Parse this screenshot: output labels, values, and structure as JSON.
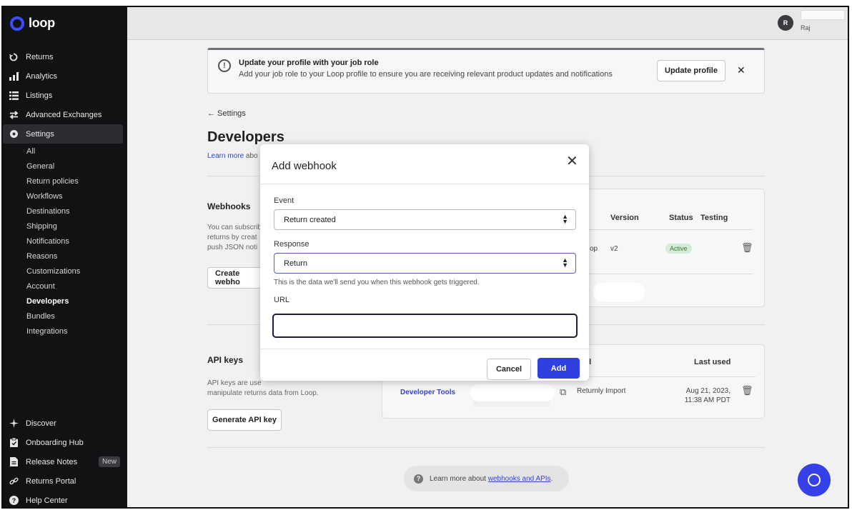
{
  "app": {
    "logo_text": "loop",
    "brand_color": "#3d4bff"
  },
  "user": {
    "avatar_initial": "R",
    "name": "Raj"
  },
  "sidebar": {
    "items": [
      {
        "label": "Returns",
        "icon": "returns-icon"
      },
      {
        "label": "Analytics",
        "icon": "analytics-icon"
      },
      {
        "label": "Listings",
        "icon": "listings-icon"
      },
      {
        "label": "Advanced Exchanges",
        "icon": "exchange-icon"
      },
      {
        "label": "Settings",
        "icon": "settings-icon"
      }
    ],
    "settings_sub": [
      "All",
      "General",
      "Return policies",
      "Workflows",
      "Destinations",
      "Shipping",
      "Notifications",
      "Reasons",
      "Customizations",
      "Account",
      "Developers",
      "Bundles",
      "Integrations"
    ],
    "bottom": [
      {
        "label": "Discover",
        "icon": "discover-icon"
      },
      {
        "label": "Onboarding Hub",
        "icon": "clipboard-icon"
      },
      {
        "label": "Release Notes",
        "icon": "document-icon",
        "badge": "New"
      },
      {
        "label": "Returns Portal",
        "icon": "link-icon"
      },
      {
        "label": "Help Center",
        "icon": "help-icon"
      }
    ]
  },
  "banner": {
    "title": "Update your profile with your job role",
    "text": "Add your job role to your Loop profile to ensure you are receiving relevant product updates and notifications",
    "button": "Update profile"
  },
  "page": {
    "back_label": "← Settings",
    "title": "Developers",
    "learn_more_link": "Learn more",
    "learn_more_rest": " abo"
  },
  "webhooks": {
    "title": "Webhooks",
    "desc_lines": [
      "You can subscrib",
      "returns by creat",
      "push JSON noti"
    ],
    "create_button": "Create webho",
    "columns": {
      "version": "Version",
      "status": "Status",
      "testing": "Testing"
    },
    "row": {
      "fragment": "op",
      "version": "v2",
      "status": "Active"
    }
  },
  "api_keys": {
    "title": "API keys",
    "desc_lines": [
      "API keys are use",
      "manipulate returns data from Loop."
    ],
    "generate_button": "Generate API key",
    "columns": {
      "label_fragment": "el",
      "last_used": "Last used"
    },
    "row": {
      "link": "Developer Tools",
      "label": "Returnly Import",
      "last_used_date": "Aug 21, 2023,",
      "last_used_time": "11:38 AM PDT"
    }
  },
  "help": {
    "text": "Learn more about ",
    "link": "webhooks and APIs",
    "end": "."
  },
  "modal": {
    "title": "Add webhook",
    "event_label": "Event",
    "event_value": "Return created",
    "response_label": "Response",
    "response_value": "Return",
    "response_hint": "This is the data we'll send you when this webhook gets triggered.",
    "url_label": "URL",
    "url_value": "",
    "cancel": "Cancel",
    "add": "Add"
  }
}
